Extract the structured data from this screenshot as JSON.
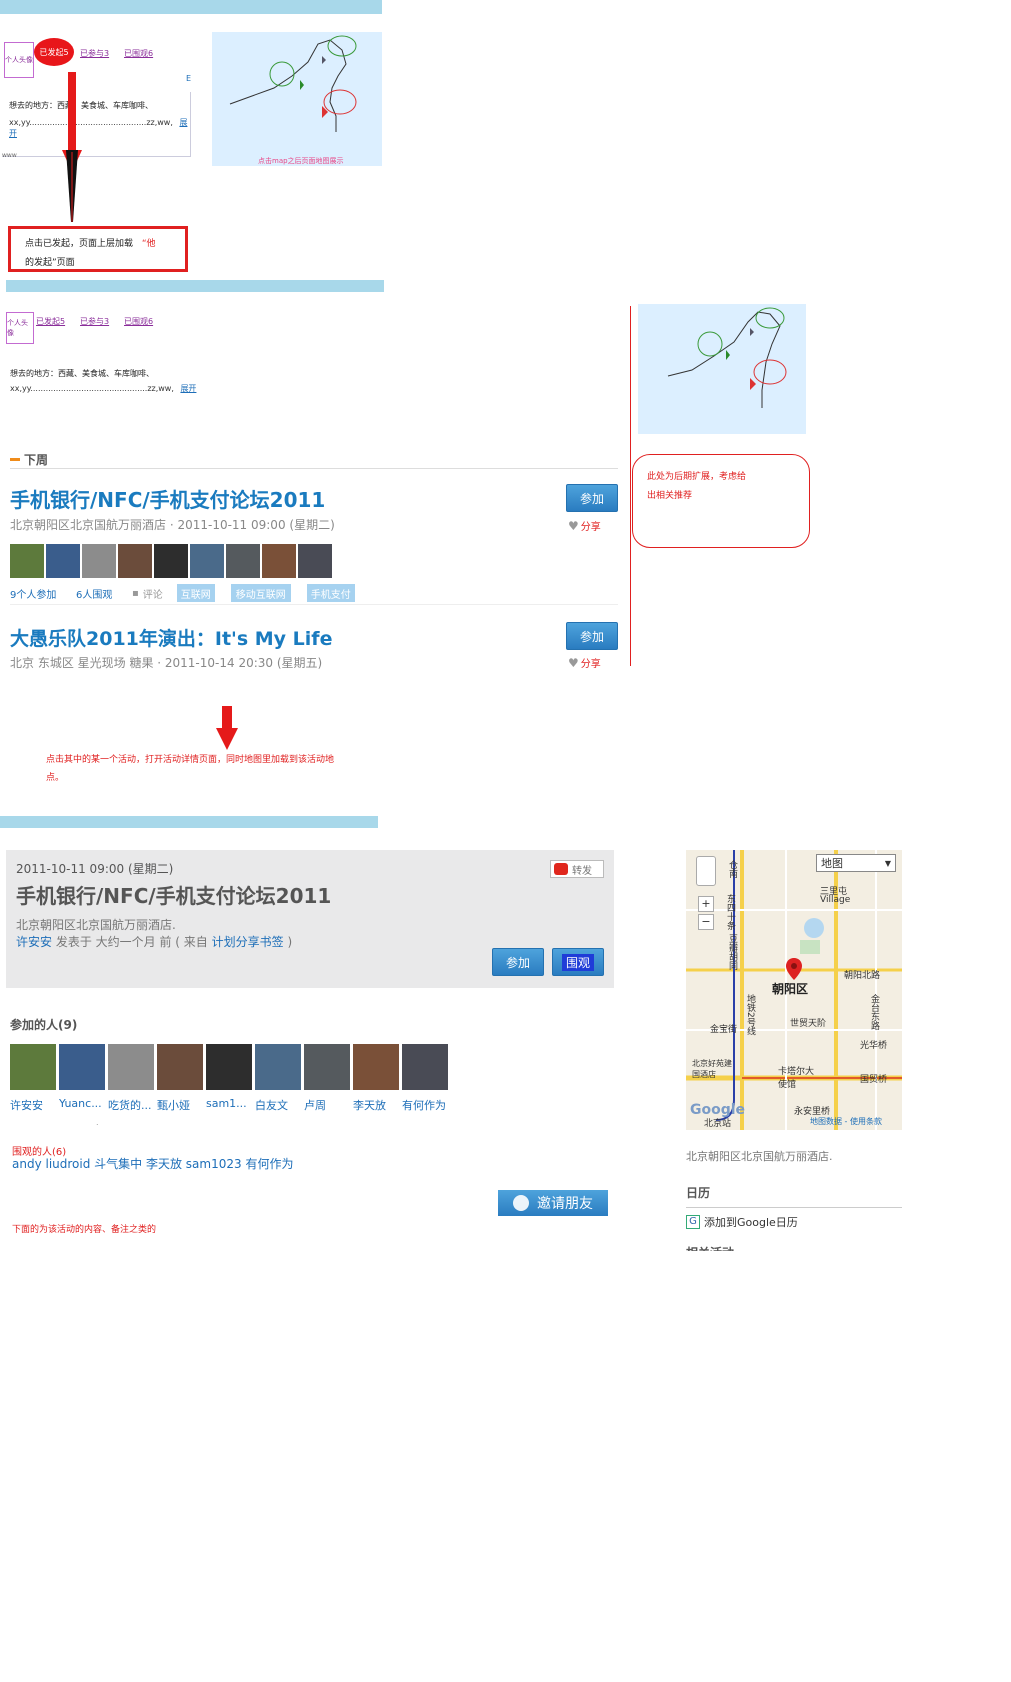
{
  "top": {
    "header_bar": "",
    "launch_badge": "已发起5",
    "joined": "已参与3",
    "watched": "已围观6",
    "avatar_label": "个人头像",
    "side_mark": "E",
    "wish_line1": "想去的地方：西藏、美食城、车库咖啡、",
    "wish_line2": "xx,yy..............................................zz,ww,",
    "expand": "展开",
    "www": "www",
    "annot_text1": "点击已发起，页面上层加载",
    "annot_quote": "“他",
    "annot_text2": "的发起”页面",
    "map_caption": "点击map之后页面地图展示"
  },
  "second": {
    "launched": "已发起5",
    "joined": "已参与3",
    "watched": "已围观6",
    "avatar_label": "个人头像",
    "wish_line1": "想去的地方：西藏、美食城、车库咖啡、",
    "wish_line2": "xx,yy..............................................zz,ww,",
    "expand": "展开",
    "section": "下周",
    "events": [
      {
        "title": "手机银行/NFC/手机支付论坛2011",
        "meta": "北京朝阳区北京国航万丽酒店 · 2011-10-11 09:00 (星期二)",
        "join": "参加",
        "share": "分享",
        "joined_count": "9个人参加",
        "watch_count": "6人围观",
        "comment": "评论",
        "tags": [
          "互联网",
          "移动互联网",
          "手机支付"
        ]
      },
      {
        "title": "大愚乐队2011年演出：It's My Life",
        "meta": "北京 东城区 星光现场 糖果 · 2011-10-14 20:30 (星期五)",
        "join": "参加",
        "share": "分享"
      }
    ],
    "right_note1": "此处为后期扩展，考虑给",
    "right_note2": "出相关推荐"
  },
  "annot2": {
    "line1": "点击其中的某一个活动，打开活动详情页面，同时地图里加载到该活动地",
    "line2": "点。"
  },
  "detail": {
    "time": "2011-10-11 09:00 (星期二)",
    "forward": "转发",
    "title": "手机银行/NFC/手机支付论坛2011",
    "place": "北京朝阳区北京国航万丽酒店.",
    "author": "许安安",
    "posted": "发表于 大约一个月 前 ( 来自",
    "source": "计划分享书签",
    "close_paren": ")",
    "join": "参加",
    "watch": "围观",
    "participants_title": "参加的人(9)",
    "participants": [
      "许安安",
      "Yuanc...",
      "吃货的...",
      "甄小娅",
      "sam1...",
      "白友文",
      "卢周",
      "李天放",
      "有何作为"
    ],
    "dot": ".",
    "watchers_title": "围观的人(6)",
    "watchers": "andy liudroid 斗气集中 李天放 sam1023 有何作为",
    "invite": "邀请朋友",
    "footnote": "下面的为该活动的内容、备注之类的"
  },
  "map": {
    "type_select": "地图",
    "zoom_in": "+",
    "zoom_out": "−",
    "labels": {
      "sanlitun": "三里屯",
      "village": "Village",
      "chaoyang": "朝阳区",
      "chaoyang_north": "朝阳北路",
      "shimao": "世贸天阶",
      "jintai": "金台东路",
      "guanghua": "光华桥",
      "guomao": "国贸桥",
      "jinbao": "金宝街",
      "subway2": "地铁2号线",
      "dongsi": "东四十条",
      "ditan": "豆瓣胡同",
      "kempinski": "卡塔尔大使馆",
      "beijingyuan": "北京好苑建国酒店",
      "yonganli": "永安里桥",
      "beijingzhan": "北京站",
      "gongti": "仓南",
      "terms": "地图数据 - 使用条款",
      "google": "Google"
    },
    "address": "北京朝阳区北京国航万丽酒店.",
    "calendar_title": "日历",
    "calendar_link": "添加到Google日历",
    "more": "相关活动"
  }
}
